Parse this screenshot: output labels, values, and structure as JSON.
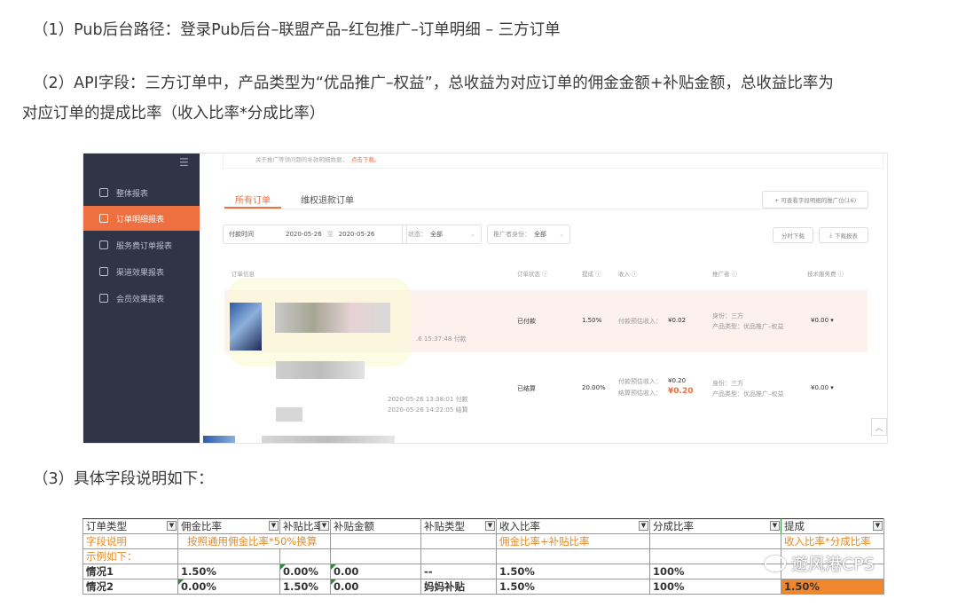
{
  "doc": {
    "p1": "（1）Pub后台路径：登录Pub后台–联盟产品–红包推广–订单明细 – 三方订单",
    "p2a": "（2）API字段：三方订单中，产品类型为“优品推广–权益”，总收益为对应订单的佣金金额+补贴金额，总收益比率为",
    "p2b": "对应订单的提成比率（收入比率*分成比率）",
    "p3": "（3）具体字段说明如下："
  },
  "screenshot": {
    "sidebar": [
      {
        "icon": "layers-icon",
        "label": "整体报表"
      },
      {
        "icon": "document-icon",
        "label": "订单明细报表",
        "active": true
      },
      {
        "icon": "service-icon",
        "label": "服务费订单报表"
      },
      {
        "icon": "channel-icon",
        "label": "渠道效果报表"
      },
      {
        "icon": "member-icon",
        "label": "会员效果报表"
      }
    ],
    "notice_text": "关于推广等领问题的补款明细数据，",
    "notice_link": "点击下载。",
    "tabs": [
      "所有订单",
      "维权退款订单"
    ],
    "tab_right_button": "+ 可查看字段明细的推广位(16)",
    "filters": {
      "time_label": "付款时间",
      "date_from": "2020-05-26",
      "date_sep": "至",
      "date_to": "2020-05-26",
      "status_label": "状态：",
      "status_value": "全部",
      "role_label": "推广者身份：",
      "role_value": "全部"
    },
    "buttons": {
      "timed_download": "分时下载",
      "download_report": "下载报表"
    },
    "columns": [
      "订单信息",
      "订单状态 ⓘ",
      "提成 ⓘ",
      "收入 ⓘ",
      "推广者 ⓘ",
      "技术服务费 ⓘ"
    ],
    "rows": [
      {
        "time": ".6 15:37:48 付款",
        "status": "已付款",
        "rate": "1.50%",
        "income_label": "付款预估收入：",
        "income_value": "¥0.02",
        "role": "身份：三方",
        "product_type": "产品类型：优品推广–权益",
        "fee": "¥0.00 ▾"
      },
      {
        "time1": "2020-05-26 13:38:01 付款",
        "time2": "2020-05-26 14:22:05 结算",
        "status": "已结算",
        "rate": "20.00%",
        "income_label": "付款预估收入：",
        "income_value": "¥0.20",
        "settle_label": "结算预估收入：",
        "settle_value": "¥0.20",
        "role": "身份：三方",
        "product_type": "产品类型：优品推广–权益",
        "fee": "¥0.00 ▾"
      }
    ]
  },
  "table": {
    "headers": [
      "订单类型",
      "佣金比率",
      "补贴比率",
      "补贴金额",
      "补贴类型",
      "收入比率",
      "分成比率",
      "提成"
    ],
    "desc_row": {
      "c0": "字段说明",
      "c1": "按照通用佣金比率*50%换算",
      "c5": "佣金比率+补贴比率",
      "c7": "收入比率*分成比率"
    },
    "example_label": "示例如下：",
    "rows": [
      [
        "情况1",
        "1.50%",
        "0.00%",
        "0.00",
        "--",
        "1.50%",
        "100%",
        ""
      ],
      [
        "情况2",
        "0.00%",
        "1.50%",
        "0.00",
        "妈妈补贴",
        "1.50%",
        "100%",
        "1.50%"
      ]
    ]
  },
  "watermark": "遊风港CPS"
}
